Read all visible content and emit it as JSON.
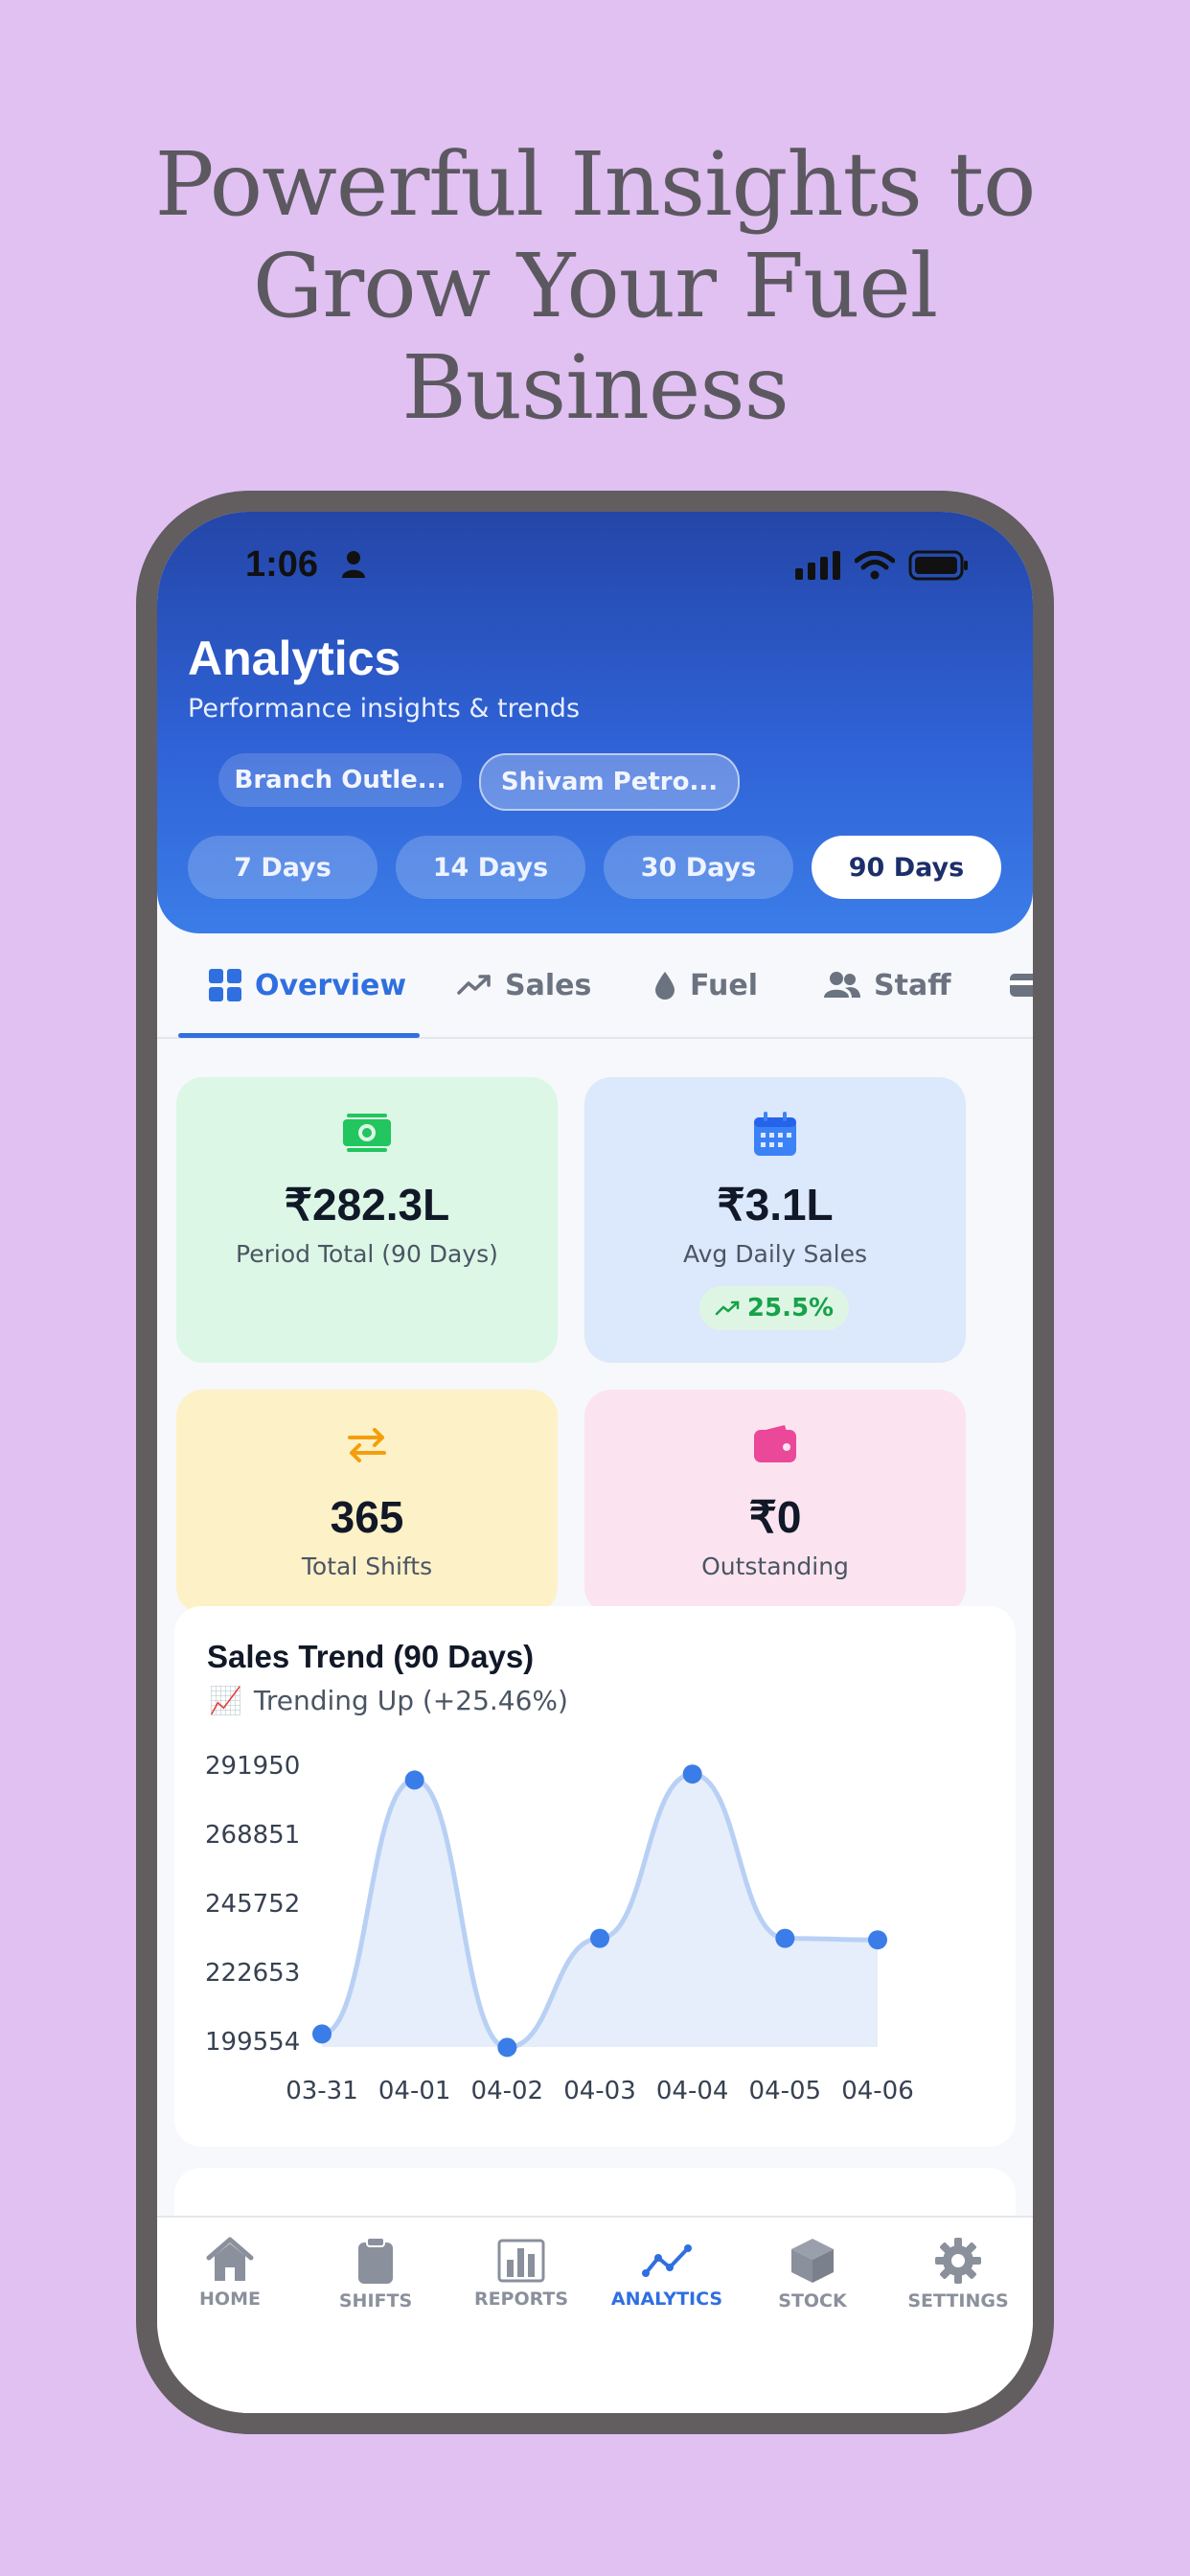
{
  "promo": {
    "headline_lines": [
      "Powerful Insights to",
      "Grow Your Fuel",
      "Business"
    ]
  },
  "status_bar": {
    "time": "1:06"
  },
  "header": {
    "title": "Analytics",
    "subtitle": "Performance insights & trends",
    "branches": [
      "Branch Outle...",
      "Shivam Petro..."
    ],
    "selected_branch": "Shivam Petro...",
    "periods": [
      "7 Days",
      "14 Days",
      "30 Days",
      "90 Days"
    ],
    "selected_period": "90 Days"
  },
  "tabs": [
    {
      "label": "Overview",
      "icon": "grid-icon",
      "active": true
    },
    {
      "label": "Sales",
      "icon": "trend-icon",
      "active": false
    },
    {
      "label": "Fuel",
      "icon": "drop-icon",
      "active": false
    },
    {
      "label": "Staff",
      "icon": "people-icon",
      "active": false
    }
  ],
  "stats": {
    "period_total": {
      "value": "₹282.3L",
      "label": "Period Total (90 Days)",
      "icon": "cash-icon",
      "color": "#22c55e"
    },
    "avg_daily": {
      "value": "₹3.1L",
      "label": "Avg Daily Sales",
      "icon": "calendar-icon",
      "color": "#3b82f6",
      "badge": "25.5%"
    },
    "total_shifts": {
      "value": "365",
      "label": "Total Shifts",
      "icon": "swap-icon",
      "color": "#f59e0b"
    },
    "outstanding": {
      "value": "₹0",
      "label": "Outstanding",
      "icon": "wallet-icon",
      "color": "#ec4899"
    }
  },
  "sales_trend": {
    "title": "Sales Trend (90 Days)",
    "subtitle": "Trending Up (+25.46%)",
    "subtitle_icon": "📈"
  },
  "chart_data": {
    "type": "area",
    "title": "Sales Trend (90 Days)",
    "x": [
      "03-31",
      "04-01",
      "04-02",
      "04-03",
      "04-04",
      "04-05",
      "04-06"
    ],
    "values": [
      202000,
      287000,
      197500,
      234000,
      289000,
      234000,
      233500
    ],
    "yticks": [
      "291950",
      "268851",
      "245752",
      "222653",
      "199554"
    ],
    "ylim": [
      199554,
      291950
    ],
    "line_color": "#b9d0f5",
    "point_color": "#3b7de8",
    "fill_color": "#e6eefb"
  },
  "bottom_nav": [
    {
      "label": "HOME",
      "icon": "home-icon",
      "active": false
    },
    {
      "label": "SHIFTS",
      "icon": "clipboard-icon",
      "active": false
    },
    {
      "label": "REPORTS",
      "icon": "bar-chart-icon",
      "active": false
    },
    {
      "label": "ANALYTICS",
      "icon": "line-chart-icon",
      "active": true
    },
    {
      "label": "STOCK",
      "icon": "box-icon",
      "active": false
    },
    {
      "label": "SETTINGS",
      "icon": "gear-icon",
      "active": false
    }
  ]
}
